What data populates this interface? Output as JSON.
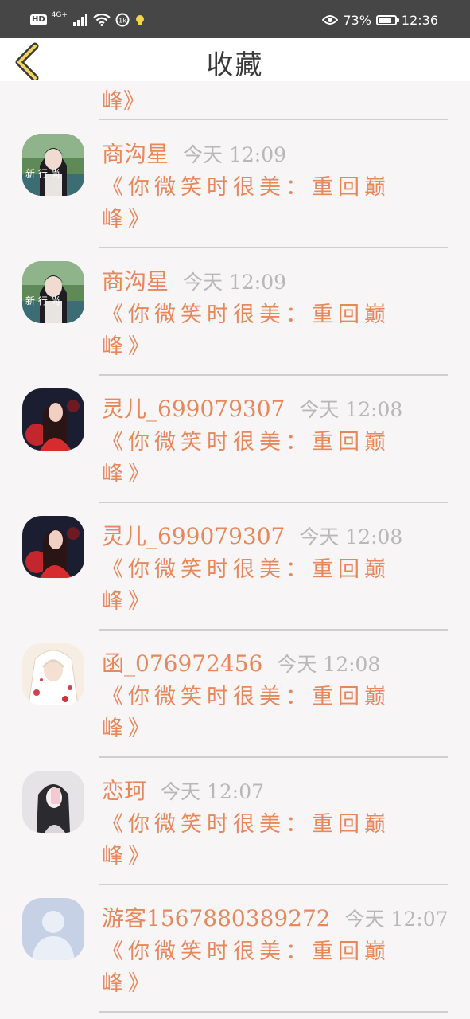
{
  "status_bar": {
    "hd": "HD",
    "network": "4G+",
    "battery": "73%",
    "battery_level": 0.73,
    "time": "12:36"
  },
  "header": {
    "title": "收藏"
  },
  "partial_item": {
    "message_tail": "峰》"
  },
  "items": [
    {
      "name": "商沟星",
      "time": "今天 12:09",
      "message": "《你微笑时很美：重回巅峰》",
      "avatar": "girl-portrait-green"
    },
    {
      "name": "商沟星",
      "time": "今天 12:09",
      "message": "《你微笑时很美：重回巅峰》",
      "avatar": "girl-portrait-green"
    },
    {
      "name": "灵儿_699079307",
      "time": "今天 12:08",
      "message": "《你微笑时很美：重回巅峰》",
      "avatar": "girl-red-dress"
    },
    {
      "name": "灵儿_699079307",
      "time": "今天 12:08",
      "message": "《你微笑时很美：重回巅峰》",
      "avatar": "girl-red-dress"
    },
    {
      "name": "函_076972456",
      "time": "今天 12:08",
      "message": "《你微笑时很美：重回巅峰》",
      "avatar": "anime-white-hair"
    },
    {
      "name": "恋珂",
      "time": "今天 12:07",
      "message": "《你微笑时很美：重回巅峰》",
      "avatar": "girl-grey-selfie"
    },
    {
      "name": "游客1567880389272",
      "time": "今天 12:07",
      "message": "《你微笑时很美：重回巅峰》",
      "avatar": "default-user"
    }
  ]
}
